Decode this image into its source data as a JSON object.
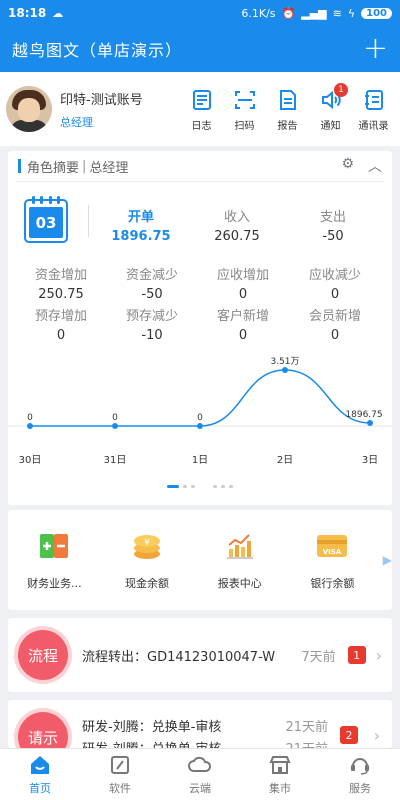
{
  "status_bar": {
    "time": "18:18",
    "speed": "6.1K/s",
    "battery": "100"
  },
  "app_bar": {
    "title": "越鸟图文（单店演示）"
  },
  "user": {
    "name": "印特-测试账号",
    "role": "总经理"
  },
  "quick_actions": [
    {
      "label": "日志",
      "icon": "log-icon"
    },
    {
      "label": "扫码",
      "icon": "scan-icon"
    },
    {
      "label": "报告",
      "icon": "report-icon"
    },
    {
      "label": "通知",
      "icon": "speaker-icon",
      "badge": "1"
    },
    {
      "label": "通讯录",
      "icon": "contacts-icon"
    }
  ],
  "summary": {
    "title": "角色摘要",
    "subtitle": "总经理",
    "day": "03",
    "top_stats": [
      {
        "label": "开单",
        "value": "1896.75"
      },
      {
        "label": "收入",
        "value": "260.75"
      },
      {
        "label": "支出",
        "value": "-50"
      }
    ],
    "grid_stats": [
      {
        "label": "资金增加",
        "value": "250.75"
      },
      {
        "label": "资金减少",
        "value": "-50"
      },
      {
        "label": "应收增加",
        "value": "0"
      },
      {
        "label": "应收减少",
        "value": "0"
      },
      {
        "label": "预存增加",
        "value": "0"
      },
      {
        "label": "预存减少",
        "value": "-10"
      },
      {
        "label": "客户新增",
        "value": "0"
      },
      {
        "label": "会员新增",
        "value": "0"
      }
    ]
  },
  "chart_data": {
    "type": "line",
    "x": [
      "30日",
      "31日",
      "1日",
      "2日",
      "3日"
    ],
    "values": [
      0,
      0,
      0,
      35100,
      1896.75
    ],
    "data_labels": [
      "0",
      "0",
      "0",
      "3.51万",
      "1896.75"
    ],
    "color": "#1a8bea",
    "grid": false
  },
  "tools": [
    {
      "label": "财务业务...",
      "icon": "finance-icon"
    },
    {
      "label": "现金余额",
      "icon": "coins-icon"
    },
    {
      "label": "报表中心",
      "icon": "bar-chart-icon"
    },
    {
      "label": "银行余额",
      "icon": "bank-card-icon"
    }
  ],
  "messages": [
    {
      "tag": "流程",
      "text": "流程转出：GD14123010047-W",
      "time": "7天前",
      "count": "1"
    },
    {
      "tag": "请示",
      "lines": [
        "研发-刘腾：兑换单-审核",
        "研发-刘腾：兑换单-审核"
      ],
      "times": [
        "21天前",
        "21天前"
      ],
      "count": "2"
    }
  ],
  "tabs": [
    {
      "label": "首页",
      "active": true
    },
    {
      "label": "软件"
    },
    {
      "label": "云端"
    },
    {
      "label": "集市"
    },
    {
      "label": "服务"
    }
  ],
  "colors": {
    "primary": "#1a8bea",
    "danger": "#e8392f",
    "tag": "#f25c6a"
  }
}
